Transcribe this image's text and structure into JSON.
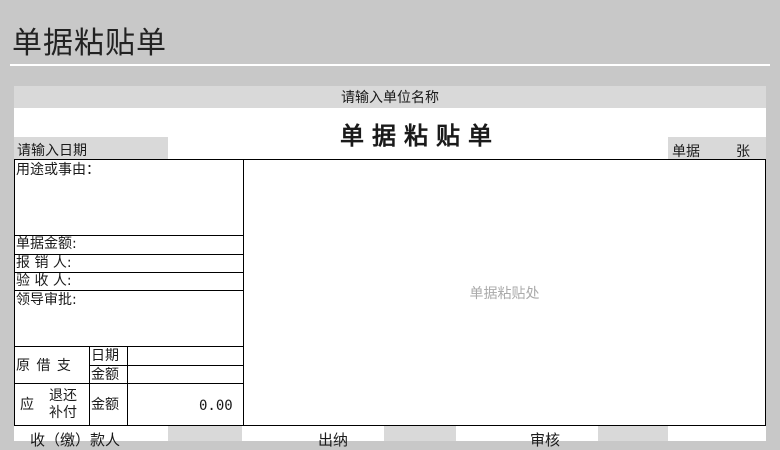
{
  "page": {
    "title": "单据粘贴单"
  },
  "form": {
    "company_placeholder": "请输入单位名称",
    "title": "单据粘贴单",
    "date_placeholder": "请输入日期",
    "receipt_count_label": "单据",
    "receipt_count_unit": "张",
    "purpose_label": "用途或事由：",
    "amount_label": "单据金额:",
    "reimburser_label": "报 销 人:",
    "inspector_label": "验 收 人:",
    "approval_label": "领导审批:",
    "advance_label": "原 借 支",
    "advance_date_label": "日期",
    "advance_amount_label": "金额",
    "settle_prefix": "应",
    "settle_refund_label": "退还",
    "settle_pay_label": "补付",
    "settle_amount_label": "金额",
    "settle_amount_value": "0.00",
    "paste_area_label": "单据粘贴处",
    "footer": {
      "payer_label": "收（缴）款人",
      "cashier_label": "出纳",
      "reviewer_label": "审核"
    }
  }
}
